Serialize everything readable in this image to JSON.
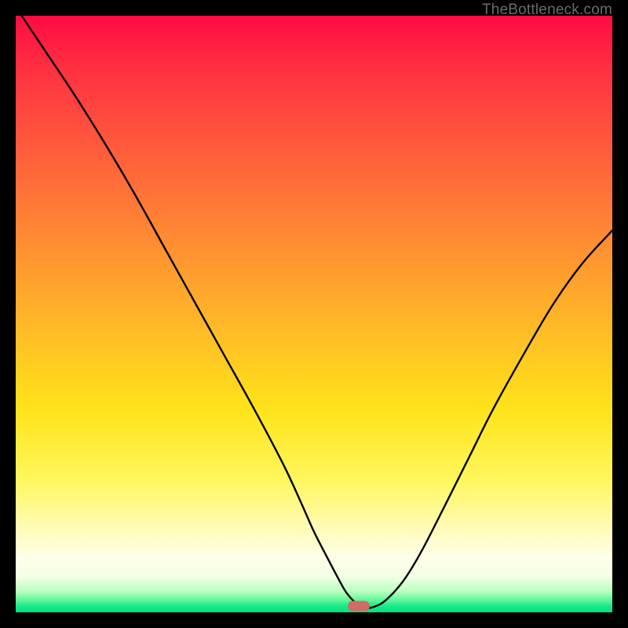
{
  "watermark": {
    "label": "TheBottleneck.com"
  },
  "colors": {
    "curve_stroke": "#000000",
    "marker_fill": "#cc6d66",
    "frame": "#000000"
  },
  "chart_data": {
    "type": "line",
    "title": "",
    "xlabel": "",
    "ylabel": "",
    "xlim": [
      0,
      100
    ],
    "ylim": [
      0,
      100
    ],
    "grid": false,
    "legend": false,
    "note": "Values estimated from pixel positions; axes are unlabeled in source image. y represents the curve height as percent of plot height (0 = bottom, 100 = top).",
    "series": [
      {
        "name": "curve",
        "x": [
          1.0,
          5,
          10,
          15,
          20,
          25,
          30,
          35,
          40,
          45,
          48,
          50,
          52,
          54,
          55.5,
          57.5,
          58.5,
          60,
          62,
          65,
          68,
          72,
          76,
          80,
          85,
          90,
          95,
          100
        ],
        "y": [
          100,
          94,
          86.5,
          78.5,
          70,
          61,
          52,
          43,
          34,
          24.5,
          18,
          13.5,
          9.6,
          5.8,
          3.2,
          1.1,
          0.7,
          0.9,
          2.0,
          5.3,
          10.2,
          18,
          26,
          34,
          43,
          51.5,
          58.5,
          64
        ]
      }
    ],
    "marker": {
      "x": 57.5,
      "y": 1.1
    }
  }
}
